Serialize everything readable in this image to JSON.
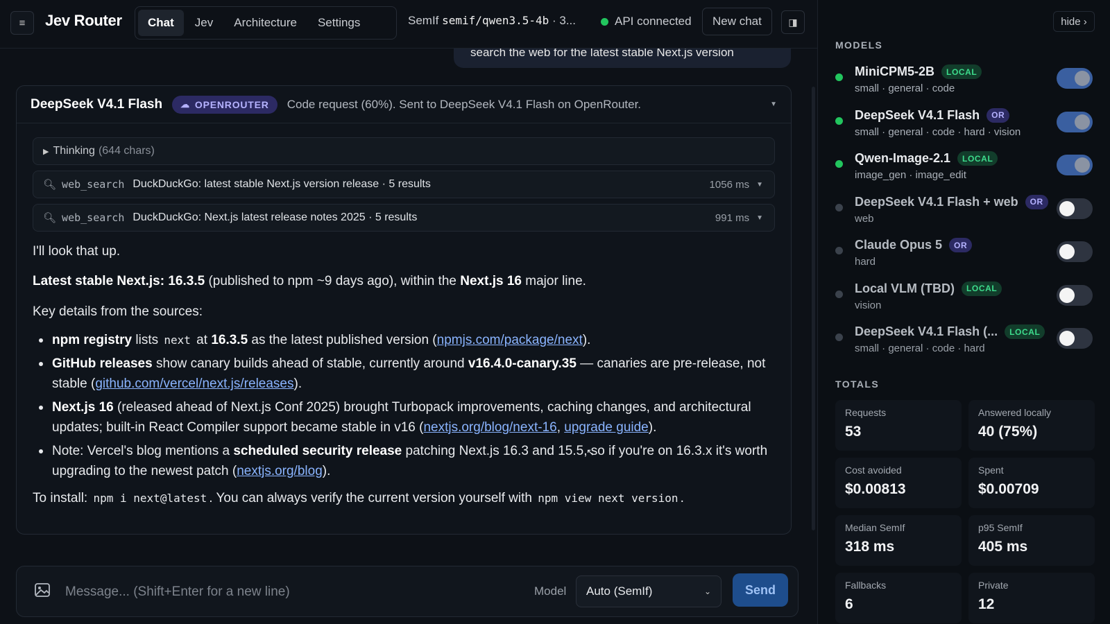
{
  "header": {
    "brand": "Jev Router",
    "tabs": [
      {
        "label": "Chat",
        "active": true
      },
      {
        "label": "Jev",
        "active": false
      },
      {
        "label": "Architecture",
        "active": false
      },
      {
        "label": "Settings",
        "active": false
      }
    ],
    "model_prefix": "SemIf",
    "model_id": "semif/qwen3.5-4b",
    "model_suffix": "· 3...",
    "api_status": "API connected",
    "new_chat": "New chat"
  },
  "chat": {
    "user_message": "search the web for the latest stable Next.js version",
    "card": {
      "model": "DeepSeek V4.1 Flash",
      "provider_badge": "OPENROUTER",
      "summary": "Code request (60%). Sent to DeepSeek V4.1 Flash on OpenRouter.",
      "thinking_label": "Thinking",
      "thinking_count": "(644 chars)",
      "tools": [
        {
          "name": "web_search",
          "desc": "DuckDuckGo: latest stable Next.js version release · 5 results",
          "time": "1056 ms"
        },
        {
          "name": "web_search",
          "desc": "DuckDuckGo: Next.js latest release notes 2025 · 5 results",
          "time": "991 ms"
        }
      ],
      "answer": {
        "intro": "I'll look that up.",
        "latest": {
          "bold1": "Latest stable Next.js: 16.3.5",
          "mid": " (published to npm ~9 days ago), within the ",
          "bold2": "Next.js 16",
          "end": " major line."
        },
        "key_details": "Key details from the sources:",
        "bullets": [
          {
            "b": "npm registry",
            "t1": " lists ",
            "code": "next",
            "t2": " at ",
            "b2": "16.3.5",
            "t3": " as the latest published version (",
            "link": "npmjs.com/package/next",
            "t4": ")."
          },
          {
            "b": "GitHub releases",
            "t1": " show canary builds ahead of stable, currently around ",
            "b2": "v16.4.0-canary.35",
            "t2": " — canaries are pre-release, not stable (",
            "link": "github.com/vercel/next.js/releases",
            "t3": ")."
          },
          {
            "b": "Next.js 16",
            "t1": " (released ahead of Next.js Conf 2025) brought Turbopack improvements, caching changes, and architectural updates; built-in React Compiler support became stable in v16 (",
            "link": "nextjs.org/blog/next-16",
            "sep": ", ",
            "link2": "upgrade guide",
            "t2": ")."
          },
          {
            "t0": "Note: Vercel's blog mentions a ",
            "b": "scheduled security release",
            "t1": " patching Next.js 16.3 and 15.5, so if you're on 16.3.x it's worth upgrading to the newest patch (",
            "link": "nextjs.org/blog",
            "t2": ")."
          }
        ],
        "install": {
          "t1": "To install: ",
          "code1": "npm i next@latest",
          "t2": ". You can always verify the current version yourself with ",
          "code2": "npm view next version",
          "t3": "."
        }
      }
    }
  },
  "composer": {
    "placeholder": "Message... (Shift+Enter for a new line)",
    "model_label": "Model",
    "model_value": "Auto (SemIf)",
    "send": "Send"
  },
  "sidebar": {
    "hide": "hide ›",
    "models_heading": "MODELS",
    "models": [
      {
        "name": "MiniCPM5-2B",
        "badge": "LOCAL",
        "tags": "small · general · code",
        "enabled": true
      },
      {
        "name": "DeepSeek V4.1 Flash",
        "badge": "OR",
        "tags": "small · general · code · hard · vision",
        "enabled": true
      },
      {
        "name": "Qwen-Image-2.1",
        "badge": "LOCAL",
        "tags": "image_gen · image_edit",
        "enabled": true
      },
      {
        "name": "DeepSeek V4.1 Flash + web",
        "badge": "OR",
        "tags": "web",
        "enabled": false
      },
      {
        "name": "Claude Opus 5",
        "badge": "OR",
        "tags": "hard",
        "enabled": false
      },
      {
        "name": "Local VLM (TBD)",
        "badge": "LOCAL",
        "tags": "vision",
        "enabled": false
      },
      {
        "name": "DeepSeek V4.1 Flash (...",
        "badge": "LOCAL",
        "tags": "small · general · code · hard",
        "enabled": false
      }
    ],
    "totals_heading": "TOTALS",
    "totals": [
      {
        "label": "Requests",
        "value": "53"
      },
      {
        "label": "Answered locally",
        "value": "40 (75%)"
      },
      {
        "label": "Cost avoided",
        "value": "$0.00813"
      },
      {
        "label": "Spent",
        "value": "$0.00709"
      },
      {
        "label": "Median SemIf",
        "value": "318 ms"
      },
      {
        "label": "p95 SemIf",
        "value": "405 ms"
      },
      {
        "label": "Fallbacks",
        "value": "6"
      },
      {
        "label": "Private",
        "value": "12"
      }
    ]
  },
  "colors": {
    "accent": "#3a5fa0",
    "status_green": "#22c55e",
    "local_badge": "#3ddc8c",
    "or_badge": "#b5b2ff",
    "link": "#8ab4ff"
  }
}
